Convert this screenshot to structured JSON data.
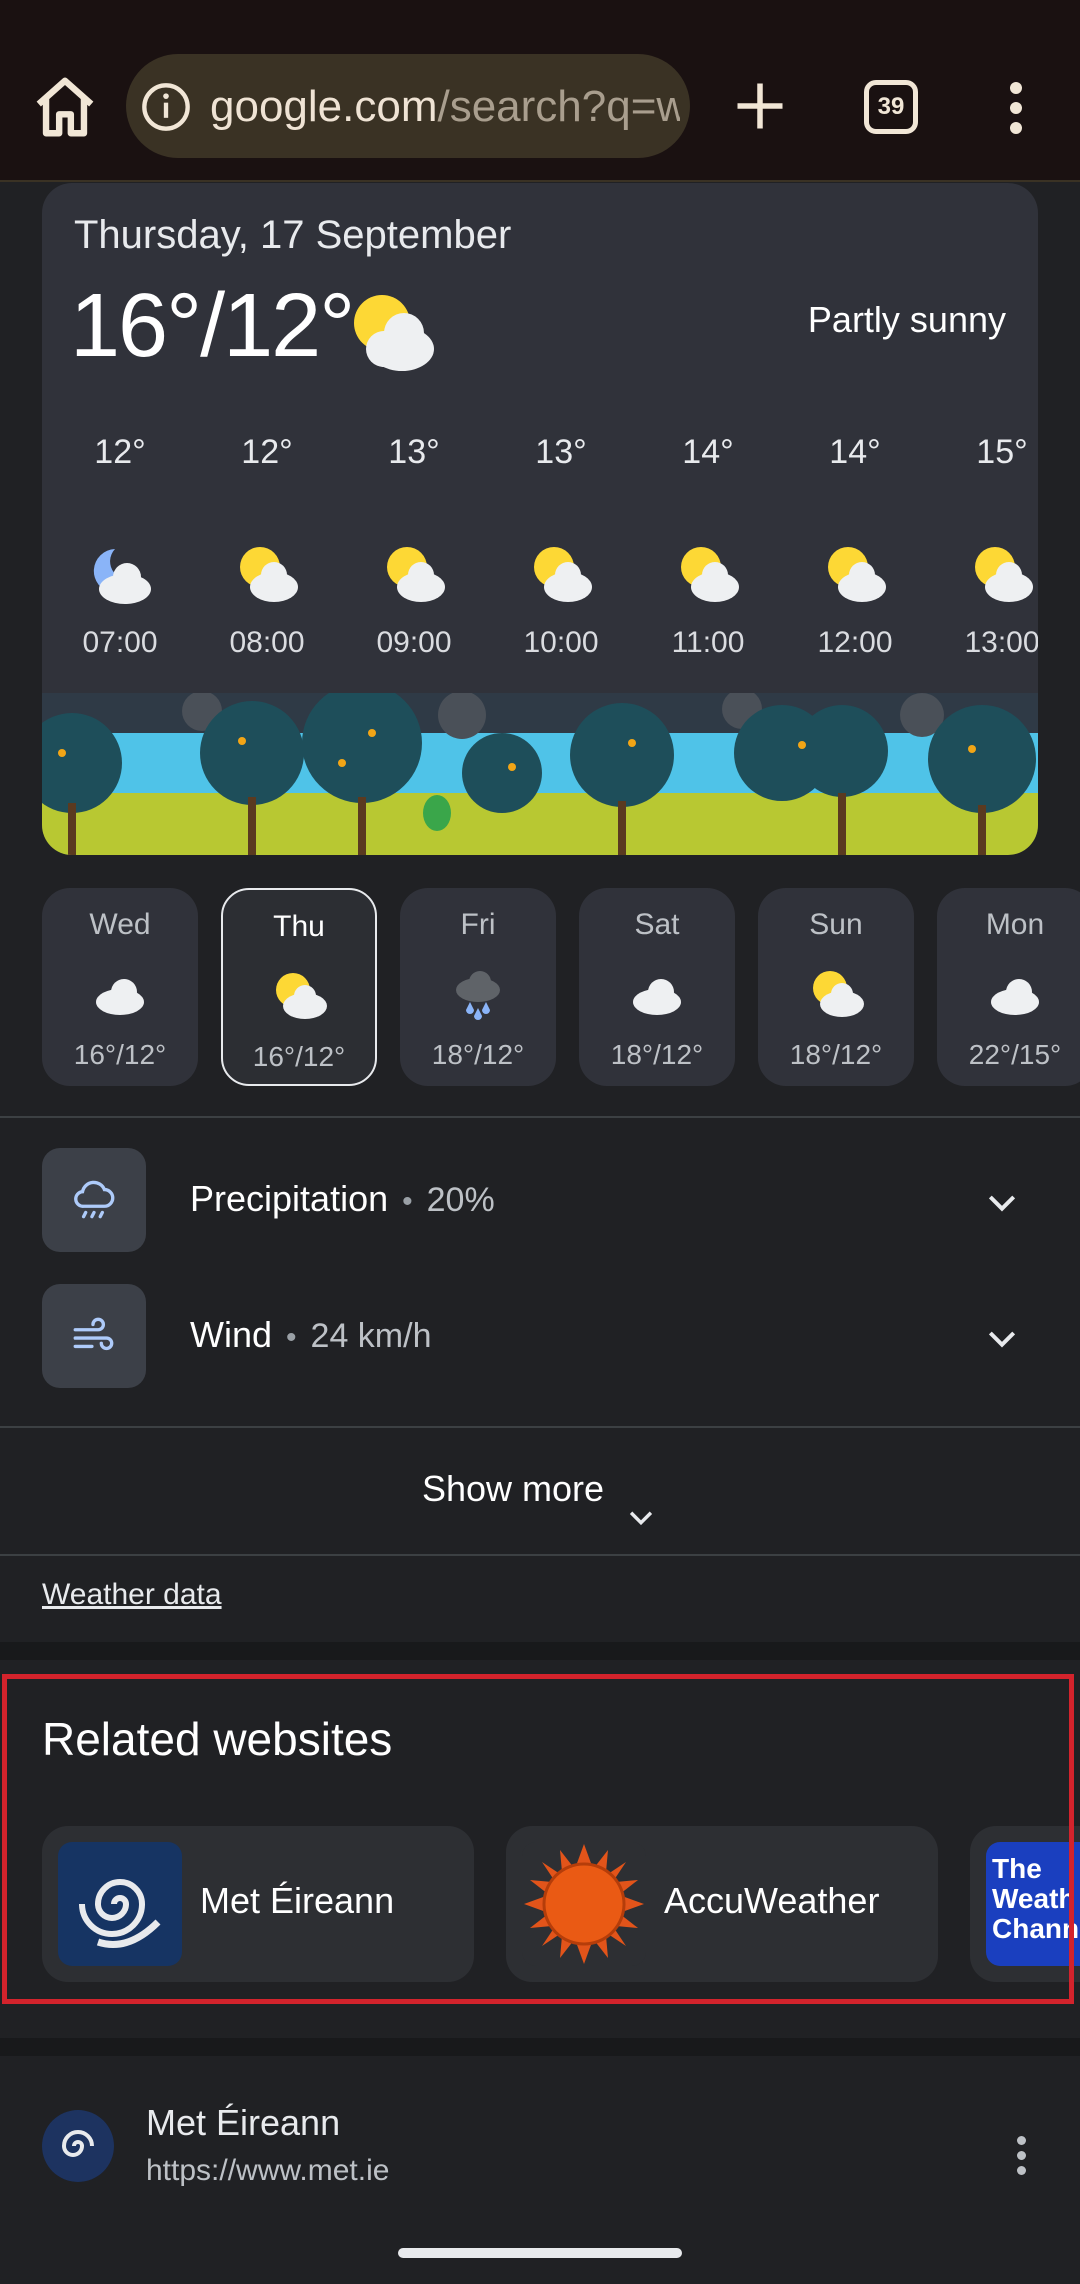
{
  "browser": {
    "url_host": "google.com",
    "url_path": "/search?q=w",
    "tab_count": "39"
  },
  "weather": {
    "date": "Thursday, 17 September",
    "temp": "16°/12°",
    "condition": "Partly sunny",
    "hourly": [
      {
        "temp": "12°",
        "time": "07:00",
        "icon": "moon-cloud-icon"
      },
      {
        "temp": "12°",
        "time": "08:00",
        "icon": "sun-cloud-icon"
      },
      {
        "temp": "13°",
        "time": "09:00",
        "icon": "sun-cloud-icon"
      },
      {
        "temp": "13°",
        "time": "10:00",
        "icon": "sun-cloud-icon"
      },
      {
        "temp": "14°",
        "time": "11:00",
        "icon": "sun-cloud-icon"
      },
      {
        "temp": "14°",
        "time": "12:00",
        "icon": "sun-cloud-icon"
      },
      {
        "temp": "15°",
        "time": "13:00",
        "icon": "sun-cloud-icon"
      }
    ],
    "daily": [
      {
        "day": "Wed",
        "temps": "16°/12°",
        "icon": "cloud-icon"
      },
      {
        "day": "Thu",
        "temps": "16°/12°",
        "icon": "sun-cloud-icon",
        "selected": true
      },
      {
        "day": "Fri",
        "temps": "18°/12°",
        "icon": "rain-cloud-icon"
      },
      {
        "day": "Sat",
        "temps": "18°/12°",
        "icon": "cloud-icon"
      },
      {
        "day": "Sun",
        "temps": "18°/12°",
        "icon": "sun-cloud-icon"
      },
      {
        "day": "Mon",
        "temps": "22°/15°",
        "icon": "cloud-icon"
      }
    ],
    "details": [
      {
        "label": "Precipitation",
        "value": "20%",
        "icon": "rain-cloud-outline-icon"
      },
      {
        "label": "Wind",
        "value": "24 km/h",
        "icon": "wind-icon"
      }
    ],
    "show_more": "Show more",
    "weather_data_link": "Weather data"
  },
  "related": {
    "title": "Related websites",
    "sites": [
      {
        "name": "Met Éireann",
        "icon": "met-eireann-logo"
      },
      {
        "name": "AccuWeather",
        "icon": "accuweather-logo"
      },
      {
        "name": "",
        "logo_text": [
          "The",
          "Weath",
          "Chann"
        ],
        "icon": "weather-channel-logo"
      }
    ]
  },
  "result": {
    "site_name": "Met Éireann",
    "url": "https://www.met.ie"
  },
  "colors": {
    "highlight": "#d3232c",
    "background": "#202124",
    "card": "#30323a",
    "sun": "#fdd835"
  }
}
